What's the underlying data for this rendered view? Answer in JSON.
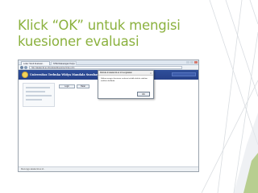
{
  "slide": {
    "title": "Klick “OK” untuk mengisi kuesioner evaluasi",
    "accent_color": "#8bb13e"
  },
  "browser": {
    "tabs": [
      {
        "label": "Loker Studi Evaluasi..."
      },
      {
        "label": "STIE  Rakuangan Kerja"
      }
    ],
    "address": "http://akademik.ac.id/evaluasi/kuesioner/index.php"
  },
  "site": {
    "name": "Universitas Terbuka Widya Mandala Surabaya"
  },
  "page": {
    "buttons": [
      {
        "label": "Login"
      },
      {
        "label": "Batal"
      }
    ]
  },
  "dialog": {
    "title": "Website di akademik.ac.id mengatakan",
    "close_icon": "close-icon",
    "message": "Silakan mengisi kuesioner evaluasi terlebih dahulu sebelum melihat nilai Anda.",
    "ok_label": "OK"
  },
  "status": {
    "text": "Menunggu akademik.ac.id..."
  }
}
